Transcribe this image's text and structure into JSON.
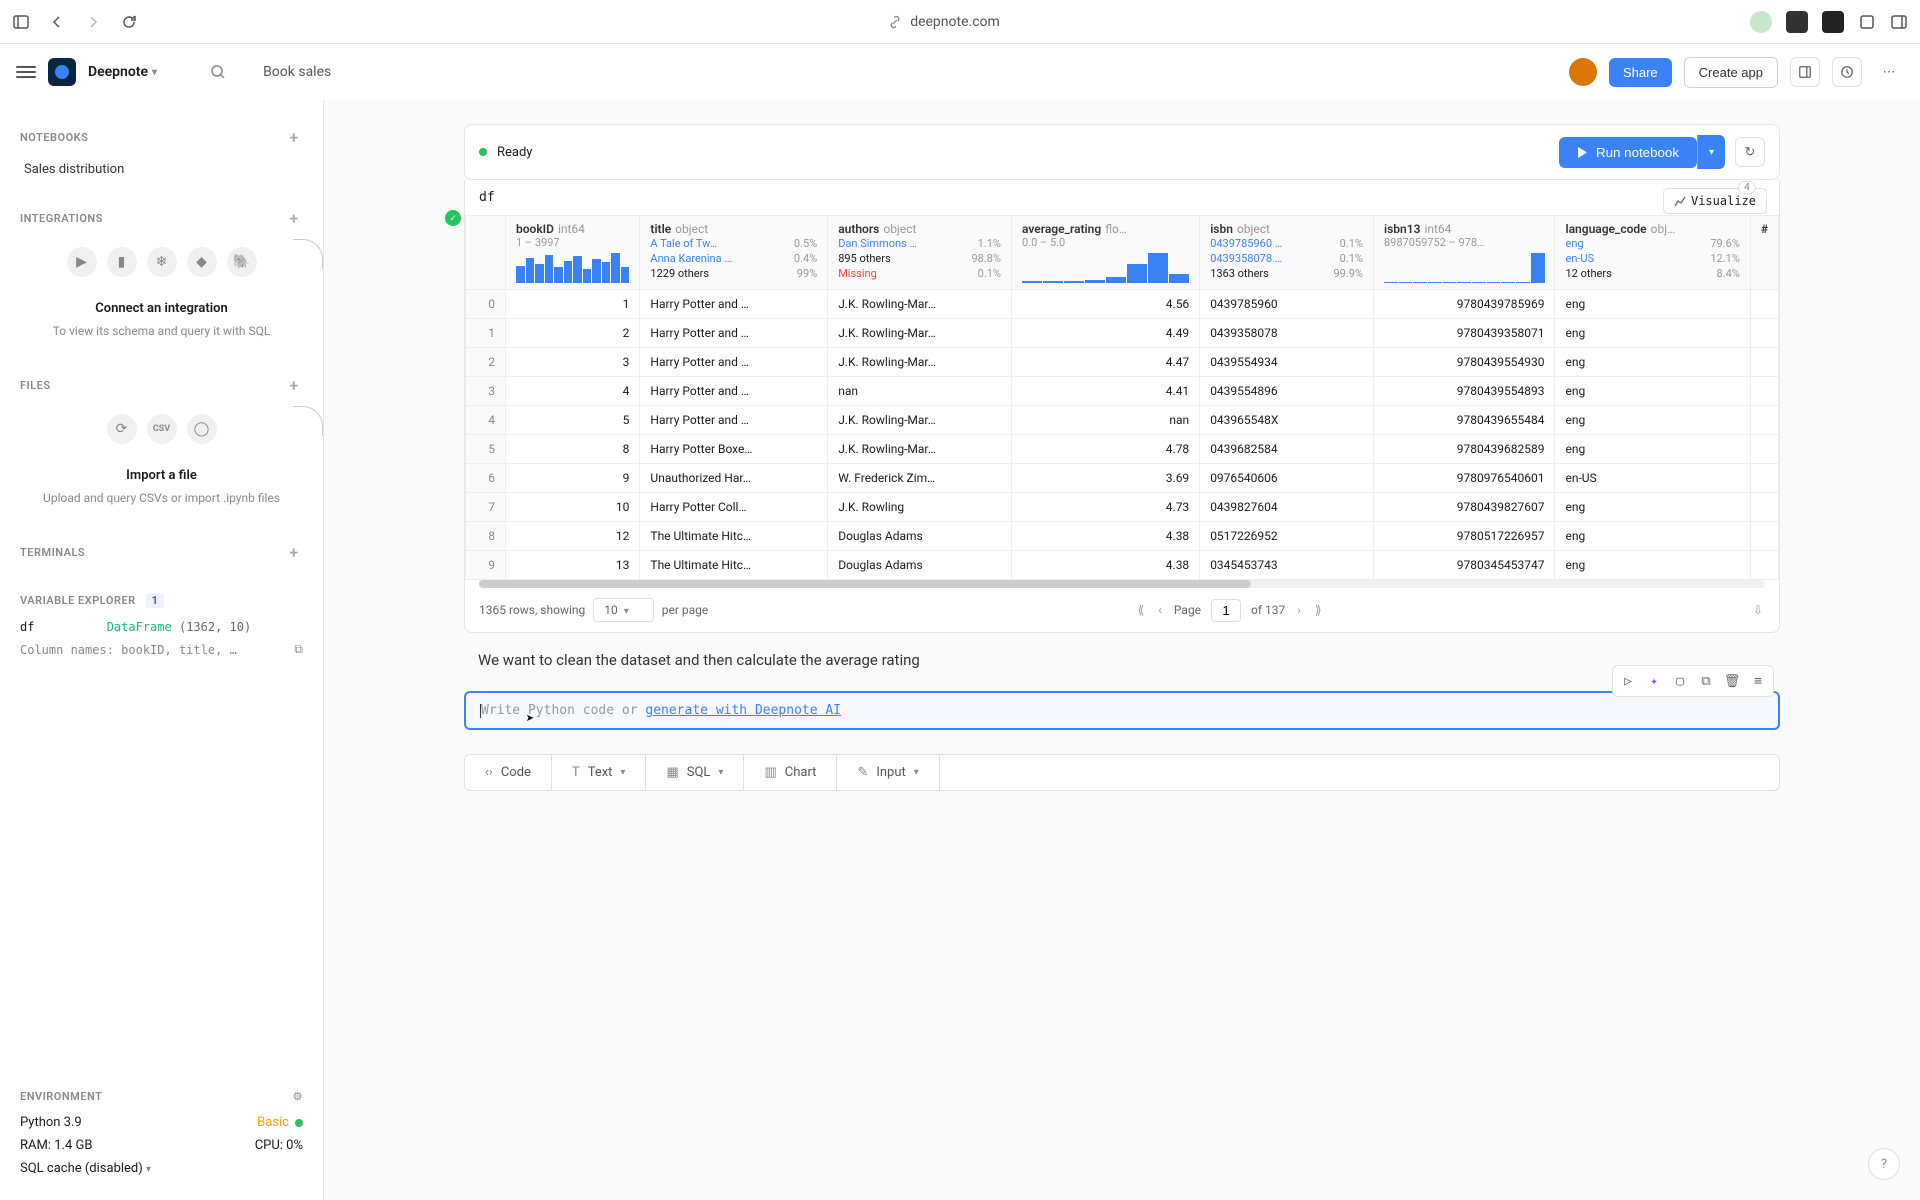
{
  "browser": {
    "url": "deepnote.com"
  },
  "header": {
    "workspace": "Deepnote",
    "breadcrumb": "Book sales",
    "share": "Share",
    "create_app": "Create app"
  },
  "sidebar": {
    "notebooks": {
      "title": "NOTEBOOKS",
      "items": [
        "Sales distribution"
      ]
    },
    "integrations": {
      "title": "INTEGRATIONS",
      "connect_title": "Connect an integration",
      "connect_desc": "To view its schema and query it with SQL"
    },
    "files": {
      "title": "FILES",
      "import_title": "Import a file",
      "import_desc": "Upload and query CSVs or import .ipynb files"
    },
    "terminals": {
      "title": "TERMINALS"
    },
    "varexp": {
      "title": "VARIABLE EXPLORER",
      "badge": "1",
      "var_name": "df",
      "var_type": "DataFrame",
      "var_shape": "(1362, 10)",
      "var_cols": "Column names: bookID, title, …"
    },
    "env": {
      "title": "ENVIRONMENT",
      "python": "Python 3.9",
      "tier": "Basic",
      "ram": "RAM: 1.4 GB",
      "cpu": "CPU: 0%",
      "sql": "SQL cache (disabled)"
    }
  },
  "notebook": {
    "status": "Ready",
    "run": "Run notebook",
    "df_name": "df",
    "visualize": "Visualize",
    "vis_count": "4",
    "columns": [
      {
        "name": "bookID",
        "type": "int64",
        "range": "1 – 3997",
        "spark": [
          55,
          80,
          60,
          90,
          50,
          70,
          85,
          45,
          75,
          65,
          95,
          50
        ]
      },
      {
        "name": "title",
        "type": "object",
        "stats": [
          [
            "A Tale of Tw…",
            "0.5%"
          ],
          [
            "Anna Karenina …",
            "0.4%"
          ],
          [
            "1229 others",
            "99%"
          ]
        ]
      },
      {
        "name": "authors",
        "type": "object",
        "stats": [
          [
            "Dan Simmons …",
            "1.1%"
          ],
          [
            "895 others",
            "98.8%"
          ],
          [
            "Missing",
            "0.1%"
          ]
        ]
      },
      {
        "name": "average_rating",
        "type": "flo…",
        "range": "0.0 – 5.0",
        "spark": [
          5,
          5,
          5,
          10,
          20,
          60,
          95,
          30
        ]
      },
      {
        "name": "isbn",
        "type": "object",
        "stats": [
          [
            "0439785960 …",
            "0.1%"
          ],
          [
            "0439358078 …",
            "0.1%"
          ],
          [
            "1363 others",
            "99.9%"
          ]
        ]
      },
      {
        "name": "isbn13",
        "type": "int64",
        "range": "8987059752 – 978…",
        "spark": [
          3,
          3,
          3,
          3,
          3,
          3,
          3,
          3,
          3,
          3,
          95
        ]
      },
      {
        "name": "language_code",
        "type": "obj…",
        "stats": [
          [
            "eng",
            "79.6%"
          ],
          [
            "en-US",
            "12.1%"
          ],
          [
            "12 others",
            "8.4%"
          ]
        ]
      }
    ],
    "rows": [
      {
        "i": "0",
        "bookID": "1",
        "title": "Harry Potter and …",
        "authors": "J.K. Rowling-Mar…",
        "rating": "4.56",
        "isbn": "0439785960",
        "isbn13": "9780439785969",
        "lang": "eng"
      },
      {
        "i": "1",
        "bookID": "2",
        "title": "Harry Potter and …",
        "authors": "J.K. Rowling-Mar…",
        "rating": "4.49",
        "isbn": "0439358078",
        "isbn13": "9780439358071",
        "lang": "eng"
      },
      {
        "i": "2",
        "bookID": "3",
        "title": "Harry Potter and …",
        "authors": "J.K. Rowling-Mar…",
        "rating": "4.47",
        "isbn": "0439554934",
        "isbn13": "9780439554930",
        "lang": "eng"
      },
      {
        "i": "3",
        "bookID": "4",
        "title": "Harry Potter and …",
        "authors": "nan",
        "rating": "4.41",
        "isbn": "0439554896",
        "isbn13": "9780439554893",
        "lang": "eng"
      },
      {
        "i": "4",
        "bookID": "5",
        "title": "Harry Potter and …",
        "authors": "J.K. Rowling-Mar…",
        "rating": "nan",
        "isbn": "043965548X",
        "isbn13": "9780439655484",
        "lang": "eng"
      },
      {
        "i": "5",
        "bookID": "8",
        "title": "Harry Potter Boxe…",
        "authors": "J.K. Rowling-Mar…",
        "rating": "4.78",
        "isbn": "0439682584",
        "isbn13": "9780439682589",
        "lang": "eng"
      },
      {
        "i": "6",
        "bookID": "9",
        "title": "Unauthorized Har…",
        "authors": "W. Frederick Zim…",
        "rating": "3.69",
        "isbn": "0976540606",
        "isbn13": "9780976540601",
        "lang": "en-US"
      },
      {
        "i": "7",
        "bookID": "10",
        "title": "Harry Potter Coll…",
        "authors": "J.K. Rowling",
        "rating": "4.73",
        "isbn": "0439827604",
        "isbn13": "9780439827607",
        "lang": "eng"
      },
      {
        "i": "8",
        "bookID": "12",
        "title": "The Ultimate Hitc…",
        "authors": "Douglas Adams",
        "rating": "4.38",
        "isbn": "0517226952",
        "isbn13": "9780517226957",
        "lang": "eng"
      },
      {
        "i": "9",
        "bookID": "13",
        "title": "The Ultimate Hitc…",
        "authors": "Douglas Adams",
        "rating": "4.38",
        "isbn": "0345453743",
        "isbn13": "9780345453747",
        "lang": "eng"
      }
    ],
    "pagination": {
      "rows_text": "1365 rows, showing",
      "per_page_val": "10",
      "per_page_label": "per page",
      "page_label": "Page",
      "page_val": "1",
      "of_label": "of 137"
    },
    "markdown": "We want to clean the dataset and then calculate the average rating",
    "code_placeholder_prefix": "Write Python code or ",
    "code_placeholder_link": "generate with Deepnote AI",
    "add": {
      "code": "Code",
      "text": "Text",
      "sql": "SQL",
      "chart": "Chart",
      "input": "Input"
    }
  }
}
